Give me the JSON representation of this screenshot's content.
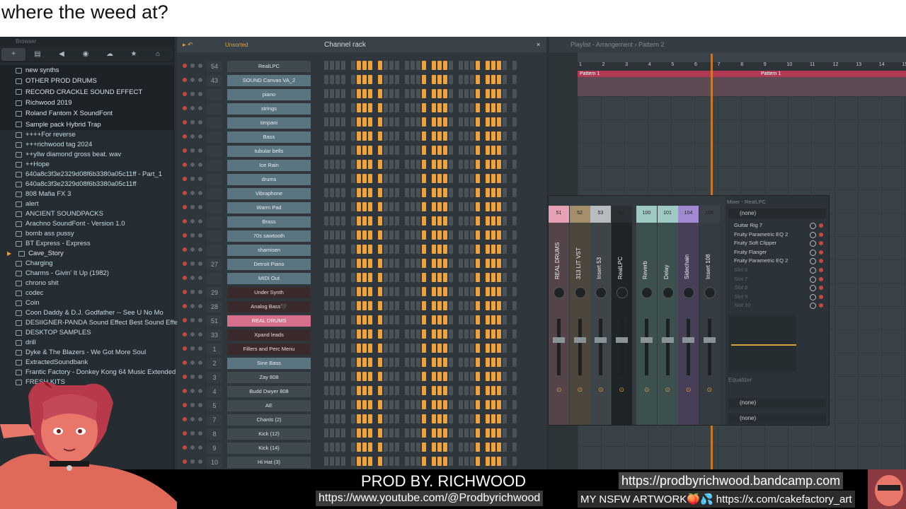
{
  "stream_title": "where the weed at?",
  "browser": {
    "header": "Browser",
    "tools": [
      "plus-icon",
      "file-icon",
      "speaker-icon",
      "globe-icon",
      "cloud-icon",
      "star-icon",
      "folder-icon"
    ],
    "top_items": [
      "new synths",
      "OTHER PROD DRUMS",
      "RECORD CRACKLE SOUND EFFECT",
      "Richwood 2019",
      "Roland Fantom X SoundFont",
      "Sample pack Hybrid Trap"
    ],
    "items": [
      "++++For reverse",
      "+++richwood tag 2024",
      "++yllw diamond gross beat. wav",
      "++Hope",
      "640a8c3f3e2329d08f6b3380a05c11ff - Part_1",
      "640a8c3f3e2329d08f6b3380a05c11ff",
      "808 Mafia FX 3",
      "alert",
      "ANCIENT  SOUNDPACKS",
      "Arachno SoundFont - Version 1.0",
      "bomb ass pussy",
      "BT Express - Express"
    ],
    "cave": "Cave_Story",
    "items2": [
      "Charging",
      "Charms - Givin' It Up (1982)",
      "chrono shit",
      "codec",
      "Coin",
      "Coon Daddy & D.J. Godfather -- See U No Mo",
      "DESIIGNER-PANDA Sound Effect Best Sound Effects TV",
      "DESKTOP SAMPLES",
      "drill",
      "Dyke & The Blazers - We Got More Soul",
      "ExtractedSoundbank",
      "Frantic Factory - Donkey Kong 64 Music Extended",
      "FRESH KITS"
    ]
  },
  "rack": {
    "sort": "Unsorted",
    "title": "Channel rack",
    "channels": [
      {
        "num": "54",
        "name": "RealLPC",
        "style": "dark"
      },
      {
        "num": "43",
        "name": "SOUND Canvas VA_2",
        "style": "light"
      },
      {
        "num": "",
        "name": "piano",
        "style": "light"
      },
      {
        "num": "",
        "name": "strings",
        "style": "light"
      },
      {
        "num": "",
        "name": "timpani",
        "style": "light"
      },
      {
        "num": "",
        "name": "Bass",
        "style": "light"
      },
      {
        "num": "",
        "name": "tubular bells",
        "style": "light"
      },
      {
        "num": "",
        "name": "Ice Rain",
        "style": "light"
      },
      {
        "num": "",
        "name": "drums",
        "style": "light"
      },
      {
        "num": "",
        "name": "Vibraphone",
        "style": "light"
      },
      {
        "num": "",
        "name": "Warm Pad",
        "style": "light"
      },
      {
        "num": "",
        "name": "Brass",
        "style": "light"
      },
      {
        "num": "",
        "name": "70s sawtooth",
        "style": "light"
      },
      {
        "num": "",
        "name": "shamisen",
        "style": "light"
      },
      {
        "num": "27",
        "name": "Detroit Piano",
        "style": "light"
      },
      {
        "num": "",
        "name": "MIDI Out",
        "style": "light"
      },
      {
        "num": "29",
        "name": "Under Synth",
        "style": "maroon"
      },
      {
        "num": "28",
        "name": "Analog Bass🖤",
        "style": "maroon"
      },
      {
        "num": "51",
        "name": "REAL DRUMS",
        "style": "pink"
      },
      {
        "num": "33",
        "name": "Xpand leads",
        "style": "maroon"
      },
      {
        "num": "1",
        "name": "Fillers and Perc Menu",
        "style": "maroon"
      },
      {
        "num": "2",
        "name": "Sine Bass",
        "style": "light"
      },
      {
        "num": "3",
        "name": "Zay 808",
        "style": "dark"
      },
      {
        "num": "4",
        "name": "Budd Dwyer 808",
        "style": "dark"
      },
      {
        "num": "5",
        "name": "AE",
        "style": "dark"
      },
      {
        "num": "7",
        "name": "Chants (2)",
        "style": "dark"
      },
      {
        "num": "8",
        "name": "Kick (12)",
        "style": "dark"
      },
      {
        "num": "9",
        "name": "Kick (14)",
        "style": "dark"
      },
      {
        "num": "10",
        "name": "Hi Hat (3)",
        "style": "dark"
      }
    ],
    "step_pattern": [
      0,
      0,
      0,
      0,
      0,
      1,
      1,
      1,
      1,
      0,
      0,
      0,
      0,
      0,
      0,
      1,
      1,
      1,
      1,
      0,
      0,
      0,
      0,
      1,
      1,
      1,
      1,
      0,
      0
    ]
  },
  "playlist": {
    "title": "Playlist - Arrangement › Pattern 2",
    "ruler": [
      "1",
      "2",
      "3",
      "4",
      "5",
      "6",
      "7",
      "8",
      "9",
      "10",
      "11",
      "12",
      "13",
      "14",
      "15"
    ],
    "clip1": "Pattern 1",
    "clip2": "Pattern 1"
  },
  "mixer": {
    "title": "Mixer - RealLPC",
    "selected": "(none)",
    "strips": [
      {
        "num": "51",
        "name": "REAL DRUMS",
        "color": "#e7a1b5",
        "body": "#54444a"
      },
      {
        "num": "52",
        "name": "313 LIT VST",
        "color": "#a58e6a",
        "body": "#4d463c"
      },
      {
        "num": "53",
        "name": "Insert 53",
        "color": "#b6bcc0",
        "body": "#3d4549"
      },
      {
        "num": "54",
        "name": "RealLPC",
        "color": "#2a2f33",
        "body": "#1f2427"
      },
      {
        "num": "100",
        "name": "Reverb",
        "color": "#9fc9c3",
        "body": "#3c504e"
      },
      {
        "num": "101",
        "name": "Delay",
        "color": "#9fc9c3",
        "body": "#3c504e"
      },
      {
        "num": "104",
        "name": "Sidechain",
        "color": "#a18ad1",
        "body": "#463f57"
      },
      {
        "num": "108",
        "name": "Insert 108",
        "color": "#3a4247",
        "body": "#343c41"
      }
    ],
    "fx": [
      "Guitar Rig 7",
      "Fruity Parametric EQ 2",
      "Fruity Soft Clipper",
      "Fruity Flanger",
      "Fruity Parametric EQ 2"
    ],
    "empty_slots": [
      "Slot 6",
      "Slot 7",
      "Slot 8",
      "Slot 9",
      "Slot 10"
    ],
    "eq_label": "Equalizer",
    "out1": "(none)",
    "out2": "(none)"
  },
  "overlay": {
    "prod": "PROD BY. RICHWOOD",
    "youtube": "https://www.youtube.com/@Prodbyrichwood",
    "bandcamp": "https://prodbyrichwood.bandcamp.com",
    "nsfw": "MY NSFW ARTWORK🍑💦 https://x.com/cakefactory_art"
  },
  "colors": {
    "accent": "#f0a23a",
    "record": "#c44a3e",
    "pink_channel": "#d6708a"
  }
}
